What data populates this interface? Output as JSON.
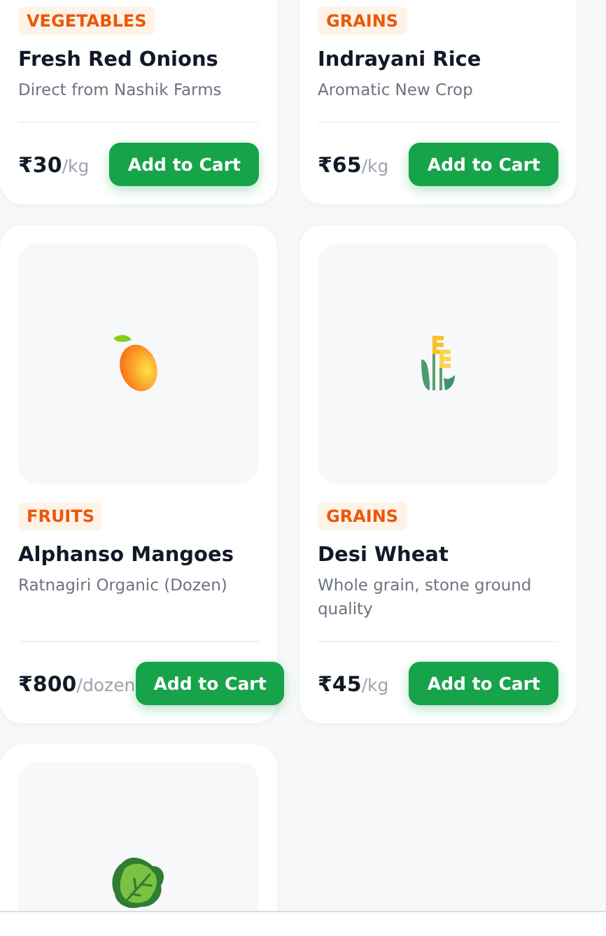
{
  "products": [
    {
      "kind": "cut",
      "category": "VEGETABLES",
      "name": "Fresh Red Onions",
      "description": "Direct from Nashik Farms",
      "price": "₹30",
      "unit": "/kg",
      "button": "Add to Cart"
    },
    {
      "kind": "cut",
      "category": "GRAINS",
      "name": "Indrayani Rice",
      "description": "Aromatic New Crop",
      "price": "₹65",
      "unit": "/kg",
      "button": "Add to Cart"
    },
    {
      "kind": "mango",
      "category": "FRUITS",
      "name": "Alphanso Mangoes",
      "description": "Ratnagiri Organic (Dozen)",
      "price": "₹800",
      "unit": "/dozen",
      "button": "Add to Cart"
    },
    {
      "kind": "wheat",
      "category": "GRAINS",
      "name": "Desi Wheat",
      "description": "Whole grain, stone ground quality",
      "price": "₹45",
      "unit": "/kg",
      "button": "Add to Cart"
    },
    {
      "kind": "greens"
    }
  ]
}
